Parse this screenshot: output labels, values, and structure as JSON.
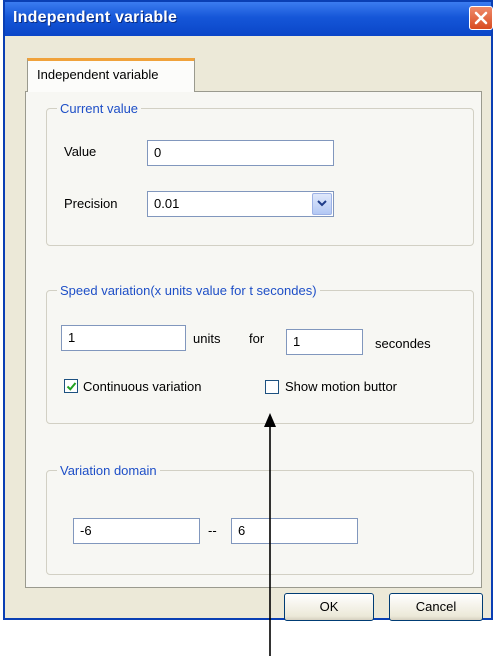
{
  "window": {
    "title": "Independent variable"
  },
  "tabs": [
    {
      "label": "Independent variable"
    }
  ],
  "current_value": {
    "legend": "Current value",
    "value_label": "Value",
    "value": "0",
    "precision_label": "Precision",
    "precision_value": "0.01"
  },
  "speed_variation": {
    "legend": "Speed variation(x units value for t secondes)",
    "units_value": "1",
    "units_label": "units",
    "for_label": "for",
    "seconds_value": "1",
    "seconds_label": "secondes",
    "continuous_label": "Continuous variation",
    "continuous_checked": true,
    "show_motion_label": "Show motion buttor",
    "show_motion_checked": false
  },
  "variation_domain": {
    "legend": "Variation domain",
    "min": "-6",
    "separator": "--",
    "max": "6"
  },
  "buttons": {
    "ok": "OK",
    "cancel": "Cancel"
  },
  "icons": {
    "close": "close-icon",
    "dropdown": "chevron-down-icon",
    "check": "check-icon",
    "annotation": "arrow-up-icon"
  },
  "colors": {
    "title_bar": "#0a46c8",
    "legend_text": "#1e4fc7",
    "close_button": "#d94b20",
    "tab_highlight": "#f0a23b"
  }
}
